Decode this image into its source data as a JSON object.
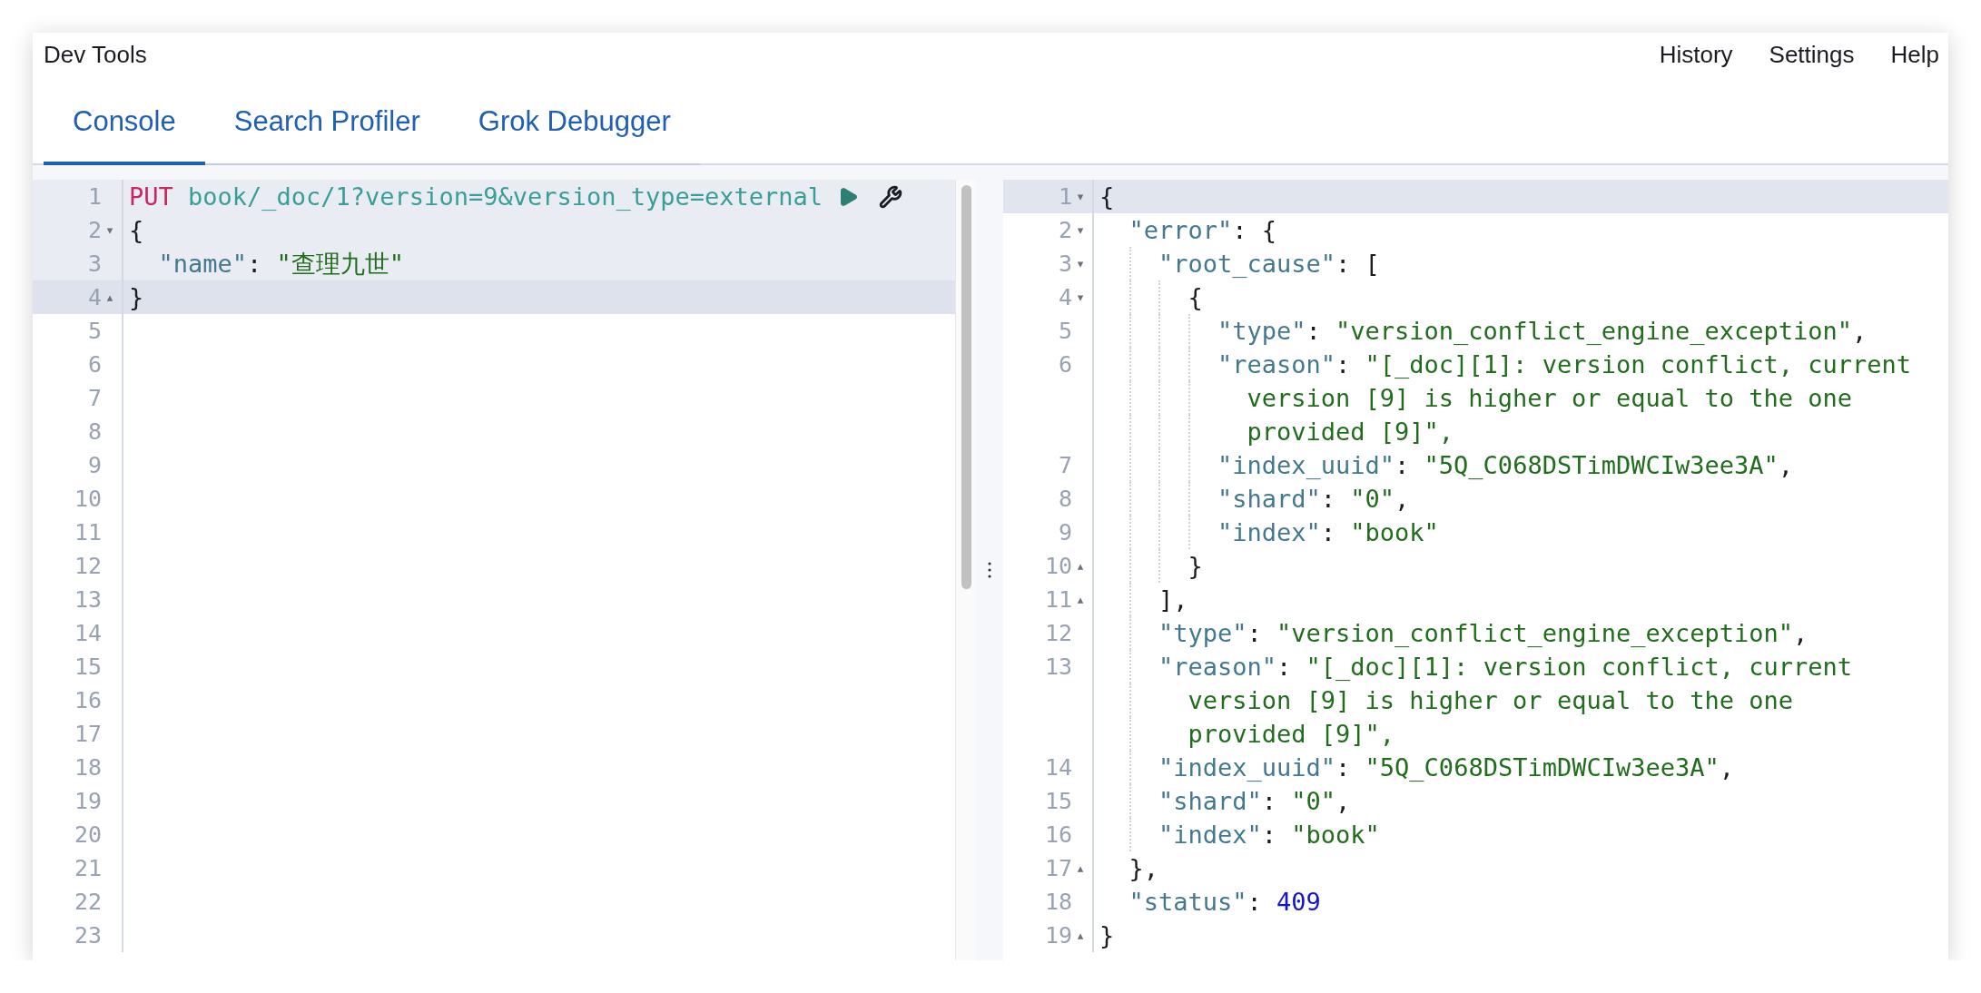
{
  "window": {
    "title": "Dev Tools"
  },
  "menu": [
    {
      "label": "History"
    },
    {
      "label": "Settings"
    },
    {
      "label": "Help"
    }
  ],
  "tabs": [
    {
      "label": "Console",
      "selected": true
    },
    {
      "label": "Search Profiler",
      "selected": false
    },
    {
      "label": "Grok Debugger",
      "selected": false
    }
  ],
  "request_editor": {
    "lines": [
      {
        "number": "1",
        "active": false,
        "in_request": true,
        "actions": true,
        "tokens": [
          {
            "kind": "method",
            "text": "PUT"
          },
          {
            "kind": "url",
            "text": " book/_doc/1?version=9&version_type=external"
          }
        ]
      },
      {
        "number": "2",
        "fold": "▾",
        "active": false,
        "in_request": true,
        "actions": false,
        "tokens": [
          {
            "kind": "punct",
            "text": "{"
          }
        ],
        "children": [
          {
            "number": "3",
            "active": false,
            "in_request": true,
            "actions": false,
            "tokens": [
              {
                "kind": "key",
                "text": "\"name\""
              },
              {
                "kind": "punct",
                "text": ": "
              },
              {
                "kind": "string",
                "text": "\"查理九世\""
              }
            ]
          }
        ]
      },
      {
        "number": "4",
        "fold": "▴",
        "active": true,
        "in_request": true,
        "actions": false,
        "tokens": [
          {
            "kind": "punct",
            "text": "}"
          }
        ]
      },
      {
        "number": "5",
        "active": false,
        "in_request": false,
        "actions": false
      },
      {
        "number": "6",
        "active": false,
        "in_request": false,
        "actions": false
      },
      {
        "number": "7",
        "active": false,
        "in_request": false,
        "actions": false
      },
      {
        "number": "8",
        "active": false,
        "in_request": false,
        "actions": false
      },
      {
        "number": "9",
        "active": false,
        "in_request": false,
        "actions": false
      },
      {
        "number": "10",
        "active": false,
        "in_request": false,
        "actions": false
      },
      {
        "number": "11",
        "active": false,
        "in_request": false,
        "actions": false
      },
      {
        "number": "12",
        "active": false,
        "in_request": false,
        "actions": false
      },
      {
        "number": "13",
        "active": false,
        "in_request": false,
        "actions": false
      },
      {
        "number": "14",
        "active": false,
        "in_request": false,
        "actions": false
      },
      {
        "number": "15",
        "active": false,
        "in_request": false,
        "actions": false
      },
      {
        "number": "16",
        "active": false,
        "in_request": false,
        "actions": false
      },
      {
        "number": "17",
        "active": false,
        "in_request": false,
        "actions": false
      },
      {
        "number": "18",
        "active": false,
        "in_request": false,
        "actions": false
      },
      {
        "number": "19",
        "active": false,
        "in_request": false,
        "actions": false
      },
      {
        "number": "20",
        "active": false,
        "in_request": false,
        "actions": false
      },
      {
        "number": "21",
        "active": false,
        "in_request": false,
        "actions": false
      },
      {
        "number": "22",
        "active": false,
        "in_request": false,
        "actions": false
      },
      {
        "number": "23",
        "active": false,
        "in_request": false,
        "actions": false
      }
    ]
  },
  "response_editor": {
    "lines": [
      {
        "number": "1",
        "fold": "▾",
        "active": true,
        "tokens": [
          {
            "kind": "punct",
            "text": "{"
          }
        ],
        "children": [
          {
            "number": "2",
            "fold": "▾",
            "active": false,
            "tokens": [
              {
                "kind": "key",
                "text": "\"error\""
              },
              {
                "kind": "punct",
                "text": ": {"
              }
            ],
            "children": [
              {
                "number": "3",
                "fold": "▾",
                "active": false,
                "tokens": [
                  {
                    "kind": "key",
                    "text": "\"root_cause\""
                  },
                  {
                    "kind": "punct",
                    "text": ": ["
                  }
                ],
                "children": [
                  {
                    "number": "4",
                    "fold": "▾",
                    "active": false,
                    "tokens": [
                      {
                        "kind": "punct",
                        "text": "{"
                      }
                    ],
                    "children": [
                      {
                        "number": "5",
                        "active": false,
                        "tokens": [
                          {
                            "kind": "key",
                            "text": "\"type\""
                          },
                          {
                            "kind": "punct",
                            "text": ": "
                          },
                          {
                            "kind": "string",
                            "text": "\"version_conflict_engine_exception\""
                          },
                          {
                            "kind": "punct",
                            "text": ","
                          }
                        ]
                      },
                      {
                        "number": "6",
                        "active": false,
                        "tokens": [
                          {
                            "kind": "key",
                            "text": "\"reason\""
                          },
                          {
                            "kind": "punct",
                            "text": ": "
                          },
                          {
                            "kind": "string",
                            "text": "\"[_doc][1]: version conflict, current"
                          }
                        ],
                        "wrap": [
                          {
                            "kind": "string",
                            "text": "version [9] is higher or equal to the one"
                          },
                          {
                            "kind": "string",
                            "text": "provided [9]\","
                          }
                        ]
                      },
                      {
                        "number": "7",
                        "active": false,
                        "tokens": [
                          {
                            "kind": "key",
                            "text": "\"index_uuid\""
                          },
                          {
                            "kind": "punct",
                            "text": ": "
                          },
                          {
                            "kind": "string",
                            "text": "\"5Q_C068DSTimDWCIw3ee3A\""
                          },
                          {
                            "kind": "punct",
                            "text": ","
                          }
                        ]
                      },
                      {
                        "number": "8",
                        "active": false,
                        "tokens": [
                          {
                            "kind": "key",
                            "text": "\"shard\""
                          },
                          {
                            "kind": "punct",
                            "text": ": "
                          },
                          {
                            "kind": "string",
                            "text": "\"0\""
                          },
                          {
                            "kind": "punct",
                            "text": ","
                          }
                        ]
                      },
                      {
                        "number": "9",
                        "active": false,
                        "tokens": [
                          {
                            "kind": "key",
                            "text": "\"index\""
                          },
                          {
                            "kind": "punct",
                            "text": ": "
                          },
                          {
                            "kind": "string",
                            "text": "\"book\""
                          }
                        ]
                      }
                    ]
                  },
                  {
                    "number": "10",
                    "fold": "▴",
                    "active": false,
                    "tokens": [
                      {
                        "kind": "punct",
                        "text": "}"
                      }
                    ]
                  }
                ]
              },
              {
                "number": "11",
                "fold": "▴",
                "active": false,
                "tokens": [
                  {
                    "kind": "punct",
                    "text": "],"
                  }
                ]
              },
              {
                "number": "12",
                "active": false,
                "tokens": [
                  {
                    "kind": "key",
                    "text": "\"type\""
                  },
                  {
                    "kind": "punct",
                    "text": ": "
                  },
                  {
                    "kind": "string",
                    "text": "\"version_conflict_engine_exception\""
                  },
                  {
                    "kind": "punct",
                    "text": ","
                  }
                ]
              },
              {
                "number": "13",
                "active": false,
                "tokens": [
                  {
                    "kind": "key",
                    "text": "\"reason\""
                  },
                  {
                    "kind": "punct",
                    "text": ": "
                  },
                  {
                    "kind": "string",
                    "text": "\"[_doc][1]: version conflict, current"
                  }
                ],
                "wrap": [
                  {
                    "kind": "string",
                    "text": "version [9] is higher or equal to the one"
                  },
                  {
                    "kind": "string",
                    "text": "provided [9]\","
                  }
                ]
              },
              {
                "number": "14",
                "active": false,
                "tokens": [
                  {
                    "kind": "key",
                    "text": "\"index_uuid\""
                  },
                  {
                    "kind": "punct",
                    "text": ": "
                  },
                  {
                    "kind": "string",
                    "text": "\"5Q_C068DSTimDWCIw3ee3A\""
                  },
                  {
                    "kind": "punct",
                    "text": ","
                  }
                ]
              },
              {
                "number": "15",
                "active": false,
                "tokens": [
                  {
                    "kind": "key",
                    "text": "\"shard\""
                  },
                  {
                    "kind": "punct",
                    "text": ": "
                  },
                  {
                    "kind": "string",
                    "text": "\"0\""
                  },
                  {
                    "kind": "punct",
                    "text": ","
                  }
                ]
              },
              {
                "number": "16",
                "active": false,
                "tokens": [
                  {
                    "kind": "key",
                    "text": "\"index\""
                  },
                  {
                    "kind": "punct",
                    "text": ": "
                  },
                  {
                    "kind": "string",
                    "text": "\"book\""
                  }
                ]
              }
            ]
          },
          {
            "number": "17",
            "fold": "▴",
            "active": false,
            "tokens": [
              {
                "kind": "punct",
                "text": "},"
              }
            ]
          },
          {
            "number": "18",
            "active": false,
            "tokens": [
              {
                "kind": "key",
                "text": "\"status\""
              },
              {
                "kind": "punct",
                "text": ": "
              },
              {
                "kind": "number",
                "text": "409"
              }
            ]
          }
        ]
      },
      {
        "number": "19",
        "fold": "▴",
        "active": false,
        "tokens": [
          {
            "kind": "punct",
            "text": "}"
          }
        ]
      }
    ]
  }
}
